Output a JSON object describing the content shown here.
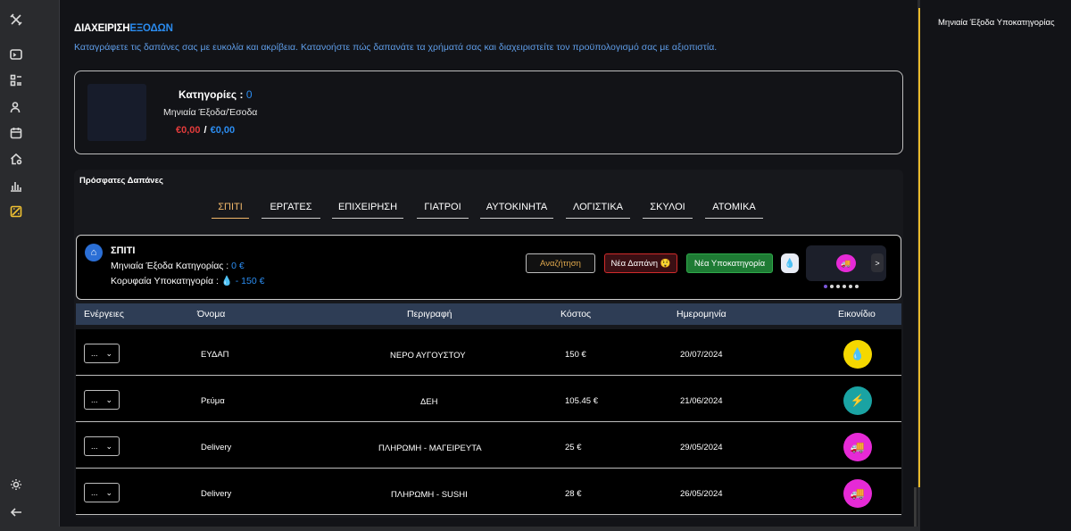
{
  "colors": {
    "accent": "#2b8cf0",
    "highlight": "#f1c232",
    "danger": "#e23b3b",
    "success": "#1e7b34"
  },
  "sidebar": {
    "items": [
      {
        "icon": "tools-icon"
      },
      {
        "icon": "terminal-icon"
      },
      {
        "icon": "list-icon"
      },
      {
        "icon": "user-icon"
      },
      {
        "icon": "calendar-icon"
      },
      {
        "icon": "home-gear-icon"
      },
      {
        "icon": "bar-chart-icon"
      },
      {
        "icon": "expense-icon",
        "active": true
      },
      {
        "icon": "sun-icon"
      },
      {
        "icon": "arrow-left-icon"
      }
    ]
  },
  "header": {
    "title_main": "ΔΙΑΧΕΙΡΙΣΗ",
    "title_accent": "ΕΞΟΔΩΝ",
    "subtitle": "Καταγράφετε τις δαπάνες σας με ευκολία και ακρίβεια. Κατανοήστε πώς δαπανάτε τα χρήματά σας και διαχειριστείτε τον προϋπολογισμό σας με αξιοπιστία."
  },
  "summary": {
    "categories_label": "Κατηγορίες :",
    "categories_count": "0",
    "monthly_label": "Μηνιαία Έξοδα/Έσοδα",
    "expenses": "€0,00",
    "separator": "/",
    "income": "€0,00"
  },
  "recent": {
    "heading": "Πρόσφατες Δαπάνες",
    "tabs": [
      "ΣΠΙΤΙ",
      "ΕΡΓΑΤΕΣ",
      "ΕΠΙΧΕΙΡΗΣΗ",
      "ΓΙΑΤΡΟΙ",
      "ΑΥΤΟΚΙΝΗΤΑ",
      "ΛΟΓΙΣΤΙΚΑ",
      "ΣΚΥΛΟΙ",
      "ΑΤΟΜΙΚΑ"
    ],
    "active_tab": "ΣΠΙΤΙ"
  },
  "category": {
    "name": "ΣΠΙΤΙ",
    "monthly_label": "Μηνιαία Έξοδα Κατηγορίας :",
    "monthly_value": "0 €",
    "top_label": "Κορυφαία Υποκατηγορία :",
    "top_value": "💧 - 150 €",
    "search_label": "Αναζήτηση",
    "new_expense_label": "Νέα Δαπάνη 😲",
    "new_sub_label": "Νέα Υποκατηγορία",
    "drop_badge": "💧",
    "carousel_next": ">"
  },
  "table": {
    "headers": [
      "Ενέργειες",
      "Όνομα",
      "Περιγραφή",
      "Κόστος",
      "Ημερομηνία",
      "Εικονίδιο"
    ],
    "action_label": "...",
    "rows": [
      {
        "name": "ΕΥΔΑΠ",
        "description": "ΝΕΡΟ ΑΥΓΟΥΣΤΟΥ",
        "cost": "150 €",
        "date": "20/07/2024",
        "icon": "💧",
        "icon_name": "water-drop-icon",
        "color": "#f5d800"
      },
      {
        "name": "Ρεύμα",
        "description": "ΔΕΗ",
        "cost": "105.45 €",
        "date": "21/06/2024",
        "icon": "⚡",
        "icon_name": "lightning-icon",
        "color": "#1aa3a3"
      },
      {
        "name": "Delivery",
        "description": "ΠΛΗΡΩΜΗ - ΜΑΓΕΙΡΕΥΤΑ",
        "cost": "25 €",
        "date": "29/05/2024",
        "icon": "🚚",
        "icon_name": "delivery-truck-icon",
        "color": "#e62ad6"
      },
      {
        "name": "Delivery",
        "description": "ΠΛΗΡΩΜΗ - SUSHI",
        "cost": "28 €",
        "date": "26/05/2024",
        "icon": "🚚",
        "icon_name": "delivery-truck-icon",
        "color": "#e62ad6"
      }
    ]
  },
  "right_panel": {
    "title": "Μηνιαία Έξοδα Υποκατηγορίας"
  }
}
